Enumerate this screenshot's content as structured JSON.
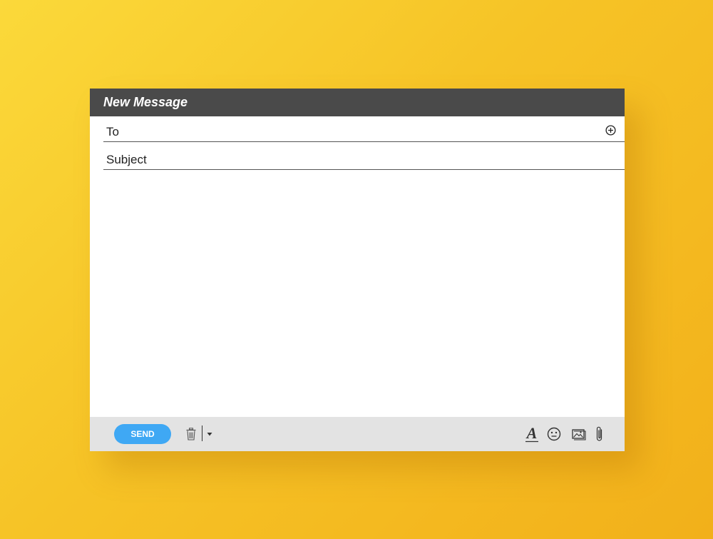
{
  "window": {
    "title": "New Message"
  },
  "compose": {
    "to_placeholder": "To",
    "to_value": "",
    "subject_placeholder": "Subject",
    "subject_value": "",
    "body_value": ""
  },
  "toolbar": {
    "send_label": "SEND",
    "icons": [
      "trash-icon",
      "chevron-down-icon",
      "font-format-icon",
      "emoji-icon",
      "image-icon",
      "paperclip-icon"
    ]
  },
  "colors": {
    "background": "#f6c326",
    "titlebar": "#4a4a4a",
    "toolbar": "#e3e3e3",
    "send_button": "#3fa8f4"
  }
}
